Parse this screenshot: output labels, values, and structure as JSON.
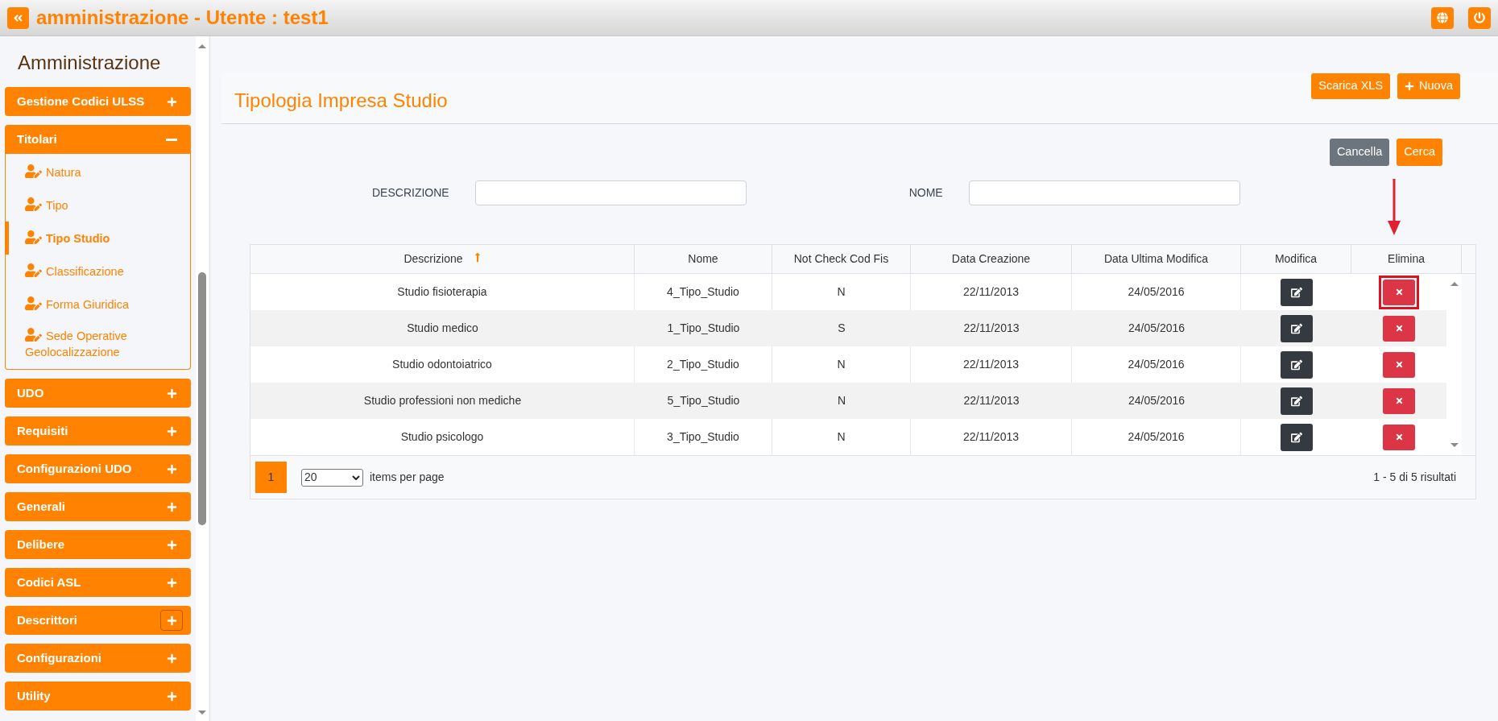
{
  "window": {
    "title": "amministrazione - Utente : test1"
  },
  "sidebar": {
    "title": "Amministrazione",
    "groups": [
      {
        "label": "Gestione Codici ULSS",
        "expanded": false,
        "focused": false
      },
      {
        "label": "Titolari",
        "expanded": true,
        "focused": false,
        "items": [
          {
            "label": "Natura",
            "selected": false
          },
          {
            "label": "Tipo",
            "selected": false
          },
          {
            "label": "Tipo Studio",
            "selected": true
          },
          {
            "label": "Classificazione",
            "selected": false
          },
          {
            "label": "Forma Giuridica",
            "selected": false
          },
          {
            "label": "Sede Operative Geolocalizzazione",
            "selected": false
          }
        ]
      },
      {
        "label": "UDO",
        "expanded": false,
        "focused": false
      },
      {
        "label": "Requisiti",
        "expanded": false,
        "focused": false
      },
      {
        "label": "Configurazioni UDO",
        "expanded": false,
        "focused": false
      },
      {
        "label": "Generali",
        "expanded": false,
        "focused": false
      },
      {
        "label": "Delibere",
        "expanded": false,
        "focused": false
      },
      {
        "label": "Codici ASL",
        "expanded": false,
        "focused": false
      },
      {
        "label": "Descrittori",
        "expanded": false,
        "focused": true
      },
      {
        "label": "Configurazioni",
        "expanded": false,
        "focused": false
      },
      {
        "label": "Utility",
        "expanded": false,
        "focused": false
      }
    ]
  },
  "page": {
    "title": "Tipologia Impresa Studio",
    "actions": [
      {
        "label": "Scarica XLS",
        "kind": "plain"
      },
      {
        "label": "Nuova",
        "kind": "add"
      }
    ]
  },
  "filters": {
    "buttons": [
      {
        "label": "Cancella",
        "kind": "secondary"
      },
      {
        "label": "Cerca",
        "kind": "primary"
      }
    ],
    "fields": [
      {
        "label": "DESCRIZIONE"
      },
      {
        "label": "NOME"
      }
    ]
  },
  "table": {
    "columns": [
      {
        "label": "Descrizione",
        "sorted": true
      },
      {
        "label": "Nome",
        "sorted": false
      },
      {
        "label": "Not Check Cod Fis",
        "sorted": false
      },
      {
        "label": "Data Creazione",
        "sorted": false
      },
      {
        "label": "Data Ultima Modifica",
        "sorted": false
      },
      {
        "label": "Modifica",
        "sorted": false
      },
      {
        "label": "Elimina",
        "sorted": false
      }
    ],
    "rows": [
      {
        "cells": [
          "Studio fisioterapia",
          "4_Tipo_Studio",
          "N",
          "22/11/2013",
          "24/05/2016"
        ],
        "highlighted": true
      },
      {
        "cells": [
          "Studio medico",
          "1_Tipo_Studio",
          "S",
          "22/11/2013",
          "24/05/2016"
        ],
        "highlighted": false
      },
      {
        "cells": [
          "Studio odontoiatrico",
          "2_Tipo_Studio",
          "N",
          "22/11/2013",
          "24/05/2016"
        ],
        "highlighted": false
      },
      {
        "cells": [
          "Studio professioni non mediche",
          "5_Tipo_Studio",
          "N",
          "22/11/2013",
          "24/05/2016"
        ],
        "highlighted": false
      },
      {
        "cells": [
          "Studio psicologo",
          "3_Tipo_Studio",
          "N",
          "22/11/2013",
          "24/05/2016"
        ],
        "highlighted": false
      }
    ]
  },
  "pagination": {
    "pages": [
      {
        "label": "1",
        "selected": true
      }
    ],
    "page_size": "20",
    "page_size_label": "items per page",
    "summary": "1 - 5 di 5 risultati"
  }
}
